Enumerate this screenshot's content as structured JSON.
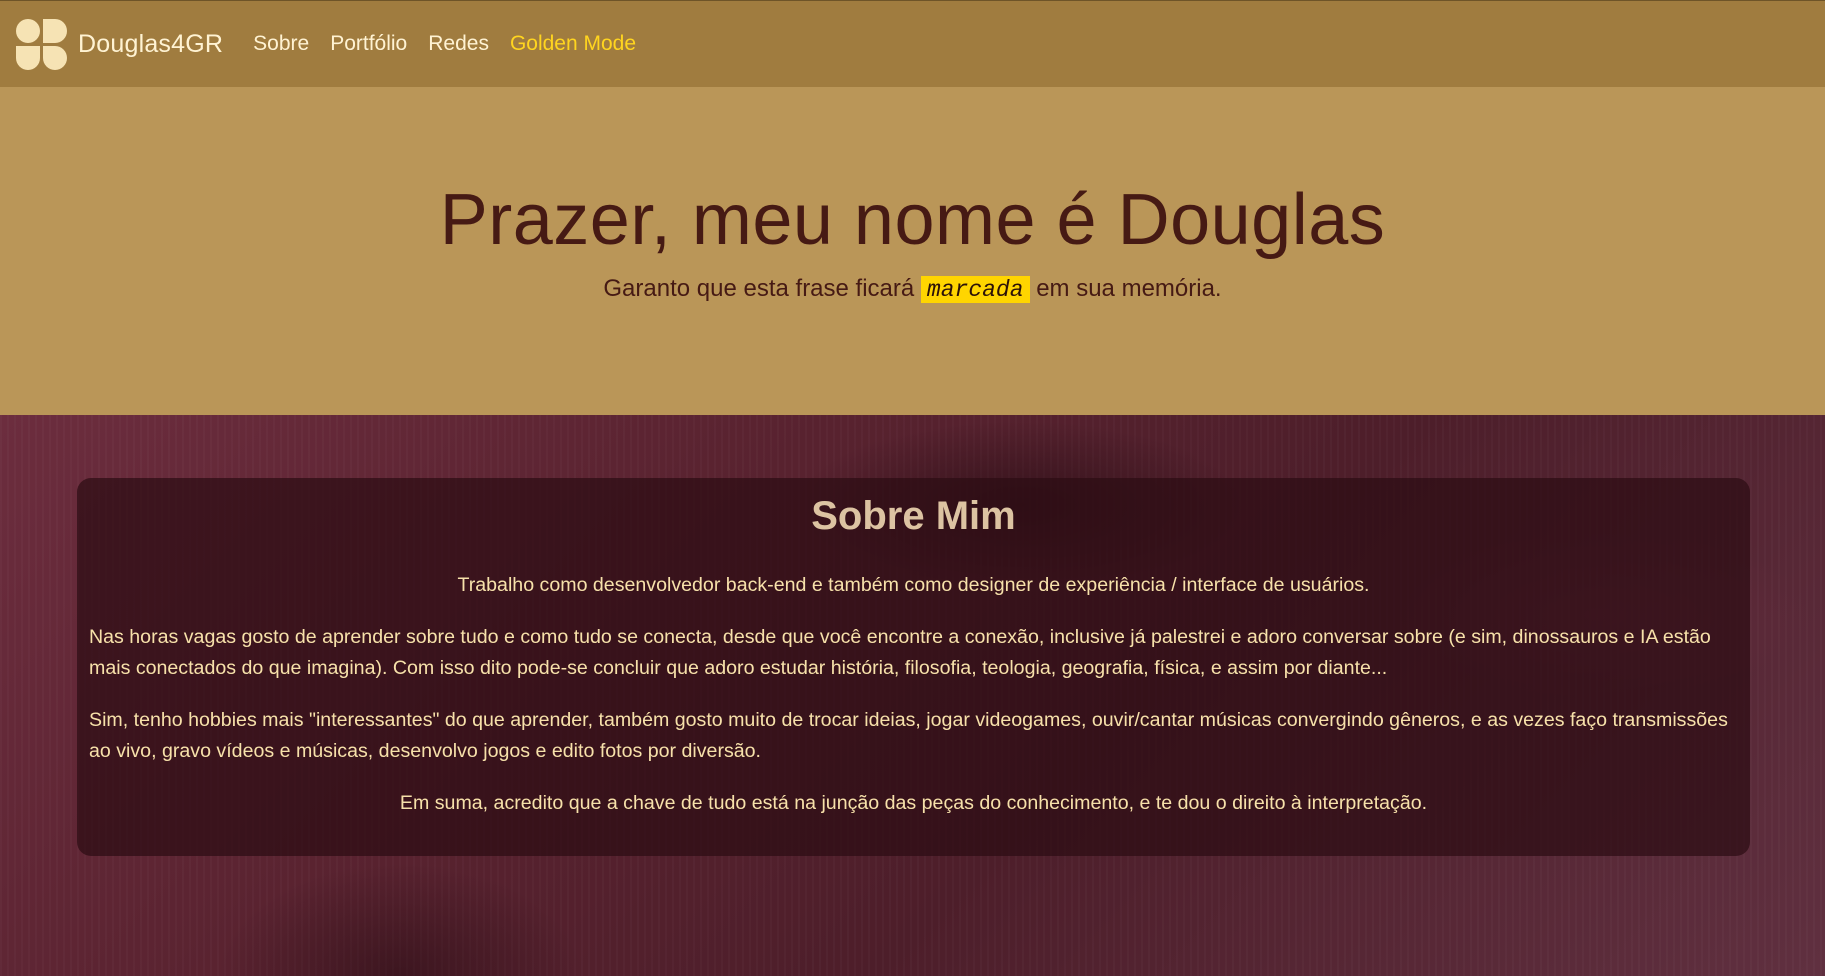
{
  "navbar": {
    "brand": "Douglas4GR",
    "links": [
      "Sobre",
      "Portfólio",
      "Redes",
      "Golden Mode"
    ],
    "logo_icon": "brand-logo-icon"
  },
  "hero": {
    "title": "Prazer, meu nome é Douglas",
    "subtitle_before": "Garanto que esta frase ficará",
    "highlight": "marcada",
    "subtitle_after": "em sua memória."
  },
  "about": {
    "title": "Sobre Mim",
    "paragraphs": [
      "Trabalho como desenvolvedor back-end e também como designer de experiência / interface de usuários.",
      "Nas horas vagas gosto de aprender sobre tudo e como tudo se conecta, desde que você encontre a conexão, inclusive já palestrei e adoro conversar sobre (e sim, dinossauros e IA estão mais conectados do que imagina). Com isso dito pode-se concluir que adoro estudar história, filosofia, teologia, geografia, física, e assim por diante...",
      "Sim, tenho hobbies mais \"interessantes\" do que aprender, também gosto muito de trocar ideias, jogar videogames, ouvir/cantar músicas convergindo gêneros, e as vezes faço transmissões ao vivo, gravo vídeos e músicas, desenvolvo jogos e edito fotos por diversão.",
      "Em suma, acredito que a chave de tudo está na junção das peças do conhecimento, e te dou o direito à interpretação."
    ]
  },
  "colors": {
    "navbar_bg": "#a07c3f",
    "hero_bg": "#ba9658",
    "hero_text": "#461a14",
    "highlight_bg": "#ffd500",
    "golden_link": "#ffd51f",
    "content_bg": "#58222f",
    "card_text": "#f7e1aa"
  }
}
